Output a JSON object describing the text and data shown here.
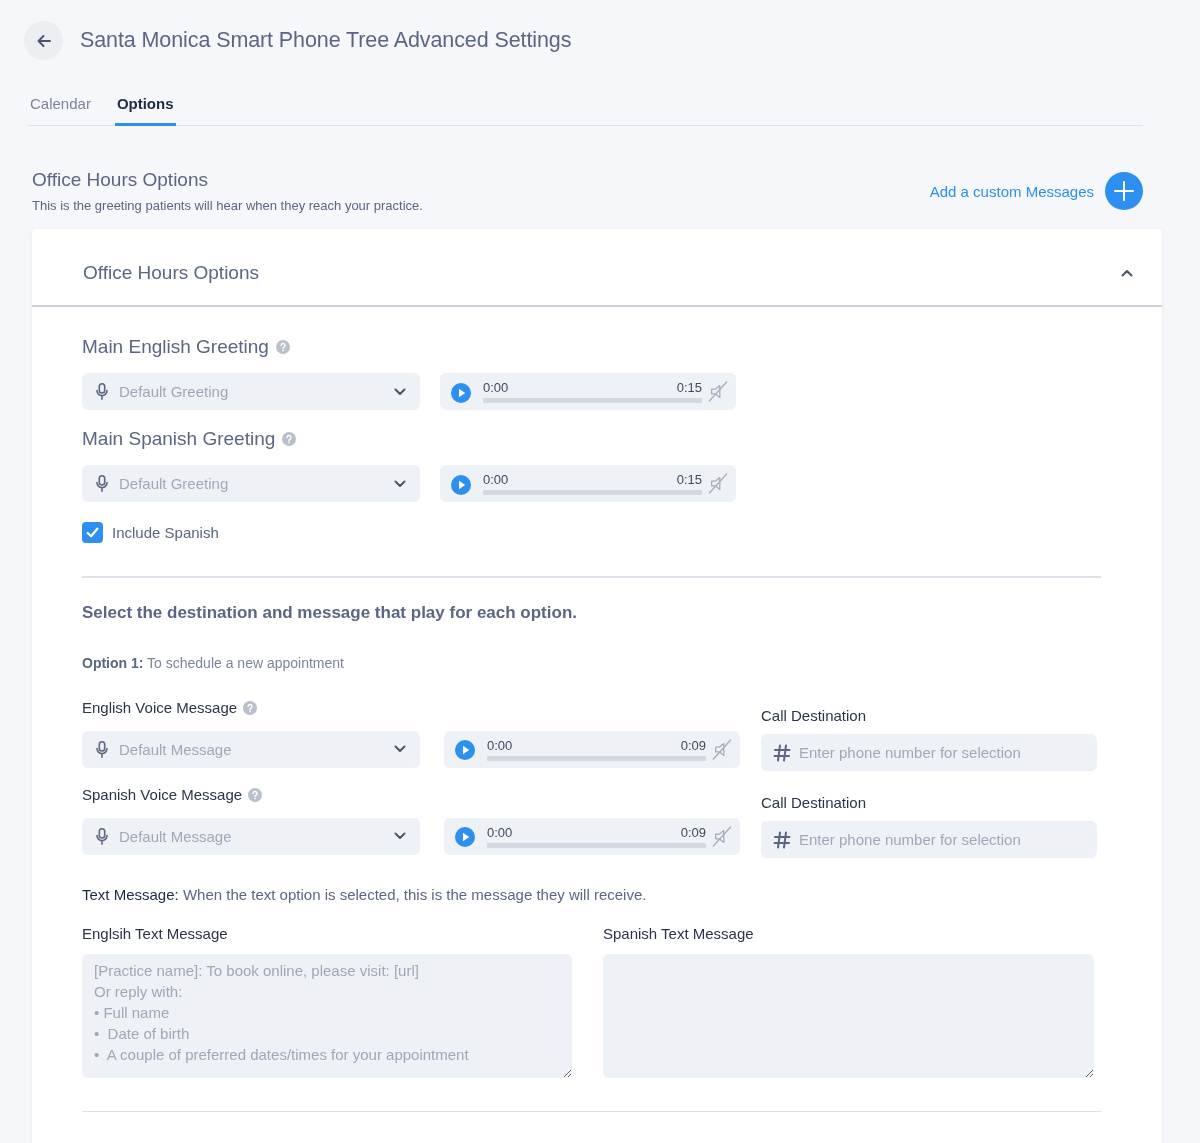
{
  "header": {
    "title": "Santa Monica Smart Phone Tree Advanced Settings"
  },
  "tabs": [
    {
      "label": "Calendar",
      "selected": false
    },
    {
      "label": "Options",
      "selected": true
    }
  ],
  "section": {
    "title": "Office Hours Options",
    "subtitle": "This is the greeting patients will hear when they reach your practice.",
    "add_link": "Add a custom Messages"
  },
  "card": {
    "title": "Office Hours Options",
    "expanded": true,
    "greetings": [
      {
        "label": "Main English Greeting",
        "dropdown": {
          "placeholder": "Default Greeting"
        },
        "player": {
          "current": "0:00",
          "duration": "0:15",
          "muted": true
        }
      },
      {
        "label": "Main Spanish Greeting",
        "dropdown": {
          "placeholder": "Default Greeting"
        },
        "player": {
          "current": "0:00",
          "duration": "0:15",
          "muted": true
        }
      }
    ],
    "include_spanish": {
      "label": "Include Spanish",
      "checked": true
    },
    "instruction": "Select the destination and message that play for each option.",
    "option": {
      "title": "**Option 1:** To schedule a new appointment",
      "messages": [
        {
          "label": "English Voice Message",
          "dropdown": {
            "placeholder": "Default Message"
          },
          "player": {
            "current": "0:00",
            "duration": "0:09",
            "muted": true
          },
          "destination": {
            "label": "Call Destination",
            "placeholder": "Enter phone number for selection"
          }
        },
        {
          "label": "Spanish Voice Message",
          "dropdown": {
            "placeholder": "Default Message"
          },
          "player": {
            "current": "0:00",
            "duration": "0:09",
            "muted": true
          },
          "destination": {
            "label": "Call Destination",
            "placeholder": "Enter phone number for selection"
          }
        }
      ],
      "text_message": {
        "note": "**Text Message:** When the text option is selected, this is the message they will receive.",
        "fields": [
          {
            "label": "Englsih Text Message",
            "placeholder": "[Practice name]: To book online, please visit: [url]\nOr reply with:\n• Full name\n•  Date of birth\n•  A couple of preferred dates/times for your appointment"
          },
          {
            "label": "Spanish Text Message"
          }
        ]
      }
    }
  }
}
